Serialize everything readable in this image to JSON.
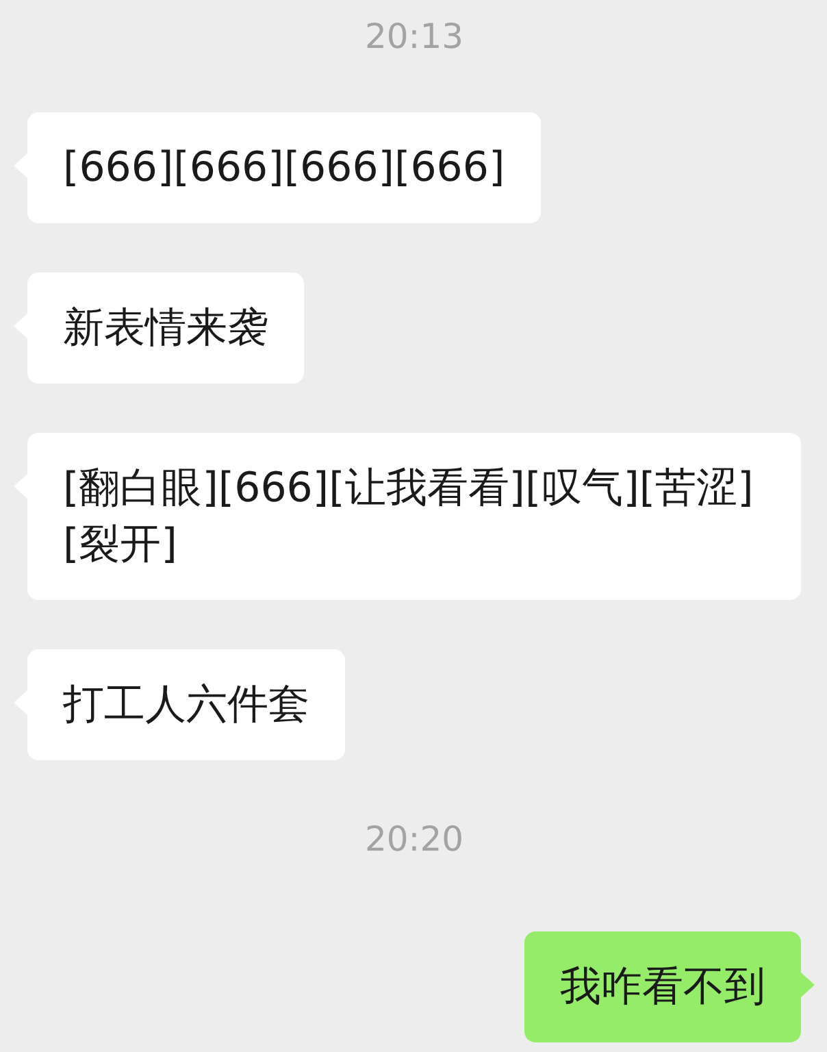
{
  "messages": [
    {
      "kind": "time",
      "text": "20:13"
    },
    {
      "kind": "left",
      "text": "[666][666][666][666]"
    },
    {
      "kind": "left",
      "text": "新表情来袭"
    },
    {
      "kind": "left",
      "text": "[翻白眼][666][让我看看][叹气][苦涩][裂开]"
    },
    {
      "kind": "left",
      "text": "打工人六件套"
    },
    {
      "kind": "time",
      "text": "20:20"
    },
    {
      "kind": "right",
      "text": "我咋看不到"
    }
  ]
}
